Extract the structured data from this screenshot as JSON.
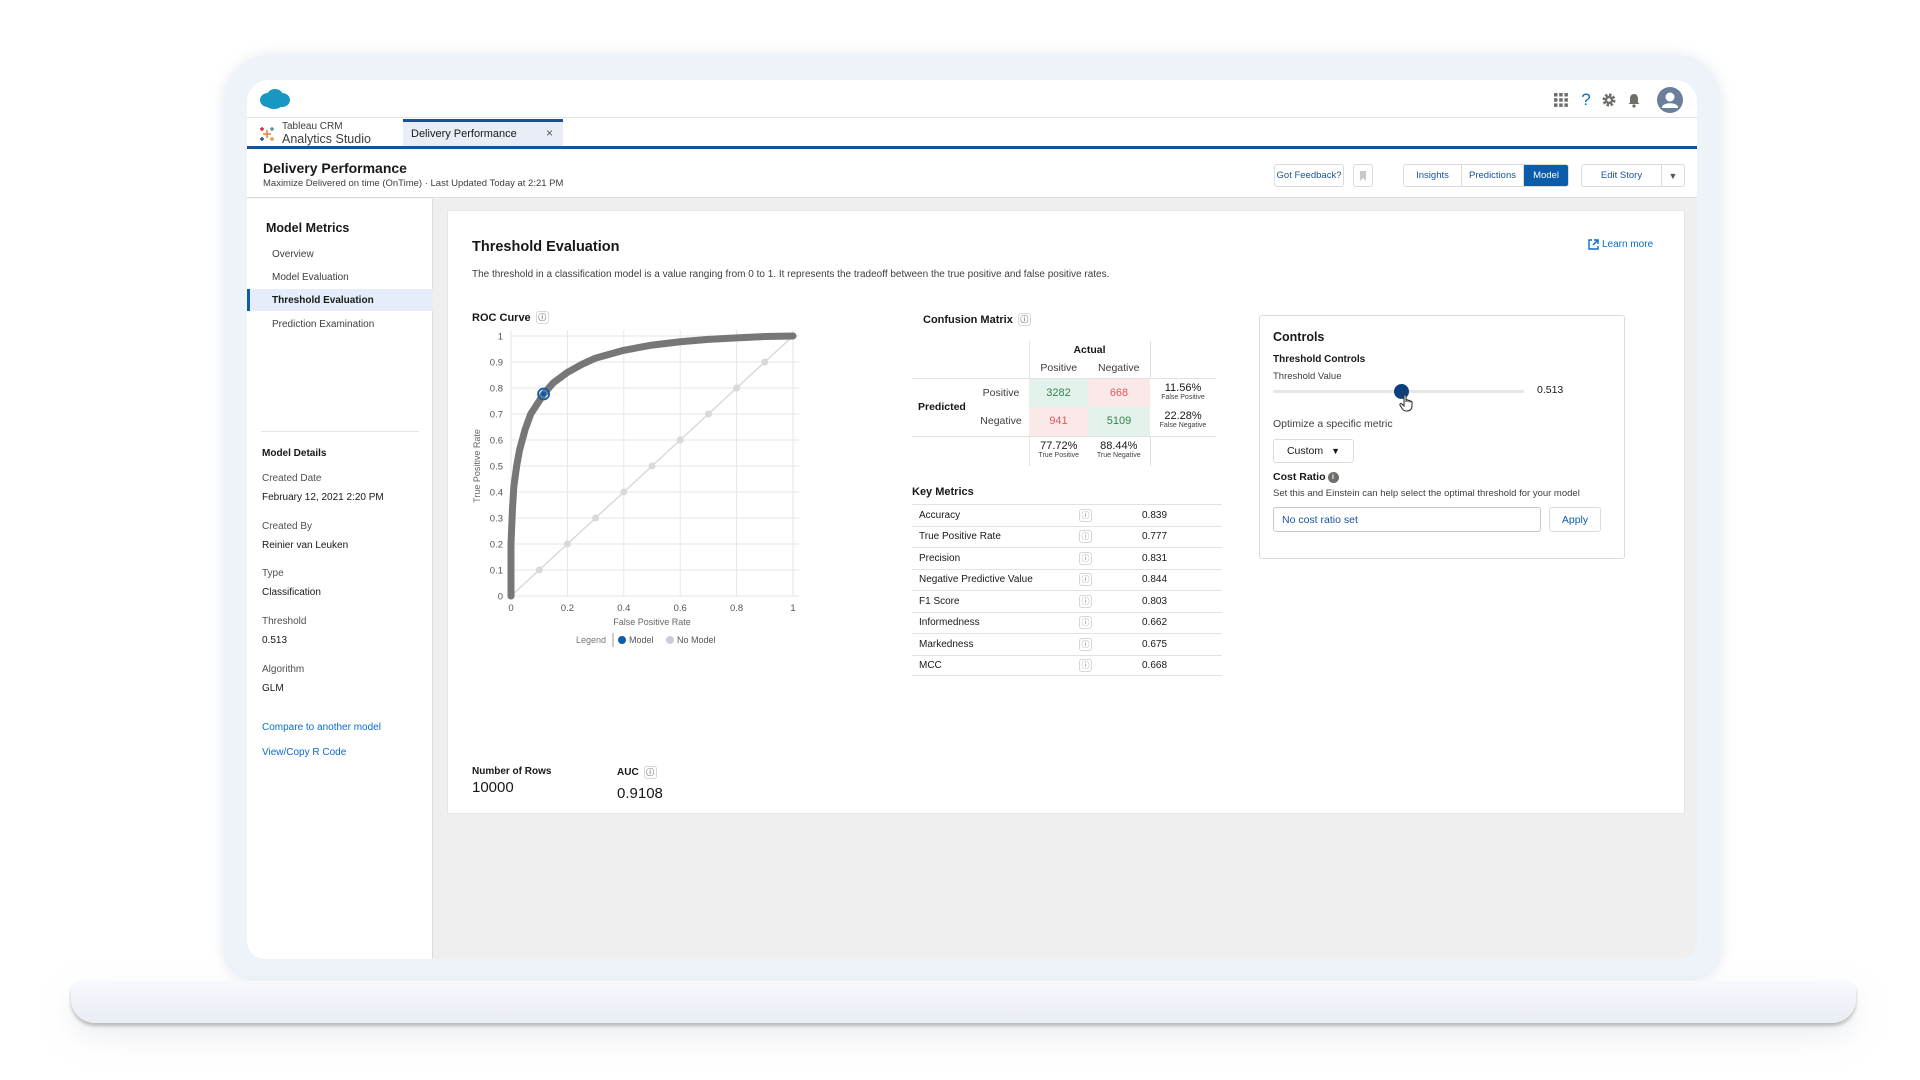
{
  "global_header": {
    "logo": "salesforce-cloud-logo",
    "icons": [
      "app-launcher-icon",
      "help-icon",
      "setup-gear-icon",
      "notification-bell-icon",
      "user-avatar"
    ]
  },
  "tabs": {
    "app_line1": "Tableau CRM",
    "app_line2": "Analytics Studio",
    "active_tab": "Delivery Performance",
    "close": "×"
  },
  "page_header": {
    "title": "Delivery Performance",
    "subtitle": "Maximize Delivered on time (OnTime) · Last Updated Today at 2:21 PM",
    "feedback_button": "Got Feedback?",
    "nav_buttons": [
      "Insights",
      "Predictions",
      "Model"
    ],
    "active_nav": "Model",
    "edit_story": "Edit Story"
  },
  "sidebar": {
    "title": "Model Metrics",
    "items": [
      {
        "label": "Overview",
        "active": false
      },
      {
        "label": "Model Evaluation",
        "active": false
      },
      {
        "label": "Threshold Evaluation",
        "active": true
      },
      {
        "label": "Prediction Examination",
        "active": false
      }
    ],
    "details_title": "Model Details",
    "details": [
      {
        "label": "Created Date",
        "value": "February 12, 2021 2:20 PM"
      },
      {
        "label": "Created By",
        "value": "Reinier van Leuken"
      },
      {
        "label": "Type",
        "value": "Classification"
      },
      {
        "label": "Threshold",
        "value": "0.513"
      },
      {
        "label": "Algorithm",
        "value": "GLM"
      }
    ],
    "links": [
      "Compare to another model",
      "View/Copy R Code"
    ]
  },
  "main": {
    "title": "Threshold Evaluation",
    "description": "The threshold in a classification model is a value ranging from 0 to 1. It represents the tradeoff between the true positive and false positive rates.",
    "learn_more": "Learn more",
    "roc_title": "ROC Curve",
    "confusion_title": "Confusion Matrix",
    "stats": {
      "rows_label": "Number of Rows",
      "rows_value": "10000",
      "auc_label": "AUC",
      "auc_value": "0.9108"
    }
  },
  "confusion_matrix": {
    "actual_label": "Actual",
    "predicted_label": "Predicted",
    "col_headers": [
      "Positive",
      "Negative"
    ],
    "row_headers": [
      "Positive",
      "Negative"
    ],
    "cells": [
      [
        "3282",
        "668"
      ],
      [
        "941",
        "5109"
      ]
    ],
    "row_rates": [
      {
        "value": "11.56%",
        "label": "False Positive"
      },
      {
        "value": "22.28%",
        "label": "False Negative"
      }
    ],
    "col_rates": [
      {
        "value": "77.72%",
        "label": "True Positive"
      },
      {
        "value": "88.44%",
        "label": "True Negative"
      }
    ],
    "colors": {
      "good_bg": "#e4f2ec",
      "good_text": "#2e844a",
      "bad_bg": "#fbe9e9",
      "bad_text": "#e05a5a"
    }
  },
  "key_metrics": {
    "title": "Key Metrics",
    "rows": [
      {
        "name": "Accuracy",
        "value": "0.839"
      },
      {
        "name": "True Positive Rate",
        "value": "0.777"
      },
      {
        "name": "Precision",
        "value": "0.831"
      },
      {
        "name": "Negative Predictive Value",
        "value": "0.844"
      },
      {
        "name": "F1 Score",
        "value": "0.803"
      },
      {
        "name": "Informedness",
        "value": "0.662"
      },
      {
        "name": "Markedness",
        "value": "0.675"
      },
      {
        "name": "MCC",
        "value": "0.668"
      }
    ]
  },
  "controls": {
    "title": "Controls",
    "threshold_controls": "Threshold Controls",
    "threshold_value_label": "Threshold Value",
    "threshold_value": "0.513",
    "threshold_fraction": 0.513,
    "optimize_label": "Optimize a specific metric",
    "optimize_selected": "Custom",
    "cost_ratio_title": "Cost Ratio",
    "cost_ratio_desc": "Set this and Einstein can help select the optimal threshold for your model",
    "cost_ratio_placeholder": "No cost ratio set",
    "apply": "Apply"
  },
  "chart_data": {
    "type": "line",
    "title": "ROC Curve",
    "xlabel": "False Positive Rate",
    "ylabel": "True Positive Rate",
    "xlim": [
      0,
      1
    ],
    "ylim": [
      0,
      1
    ],
    "x_ticks": [
      "0",
      "0.2",
      "0.4",
      "0.6",
      "0.8",
      "1"
    ],
    "y_ticks": [
      "0",
      "0.1",
      "0.2",
      "0.3",
      "0.4",
      "0.5",
      "0.6",
      "0.7",
      "0.8",
      "0.9",
      "1"
    ],
    "grid": true,
    "legend_title": "Legend",
    "legend_position": "bottom",
    "series": [
      {
        "name": "Model",
        "color": "#777777",
        "x": [
          0,
          0.0,
          0.005,
          0.01,
          0.02,
          0.03,
          0.05,
          0.07,
          0.1,
          0.1156,
          0.15,
          0.2,
          0.25,
          0.3,
          0.4,
          0.5,
          0.6,
          0.7,
          0.8,
          0.9,
          1.0
        ],
        "y": [
          0,
          0.2,
          0.33,
          0.42,
          0.5,
          0.56,
          0.64,
          0.7,
          0.75,
          0.777,
          0.82,
          0.86,
          0.89,
          0.915,
          0.945,
          0.965,
          0.978,
          0.987,
          0.993,
          0.998,
          1.0
        ]
      },
      {
        "name": "No Model",
        "color": "#c9ced6",
        "x": [
          0,
          0.1,
          0.2,
          0.3,
          0.4,
          0.5,
          0.6,
          0.7,
          0.8,
          0.9,
          1.0
        ],
        "y": [
          0,
          0.1,
          0.2,
          0.3,
          0.4,
          0.5,
          0.6,
          0.7,
          0.8,
          0.9,
          1.0
        ]
      }
    ],
    "highlight_point": {
      "x": 0.1156,
      "y": 0.777,
      "color": "#0b5cab"
    }
  }
}
